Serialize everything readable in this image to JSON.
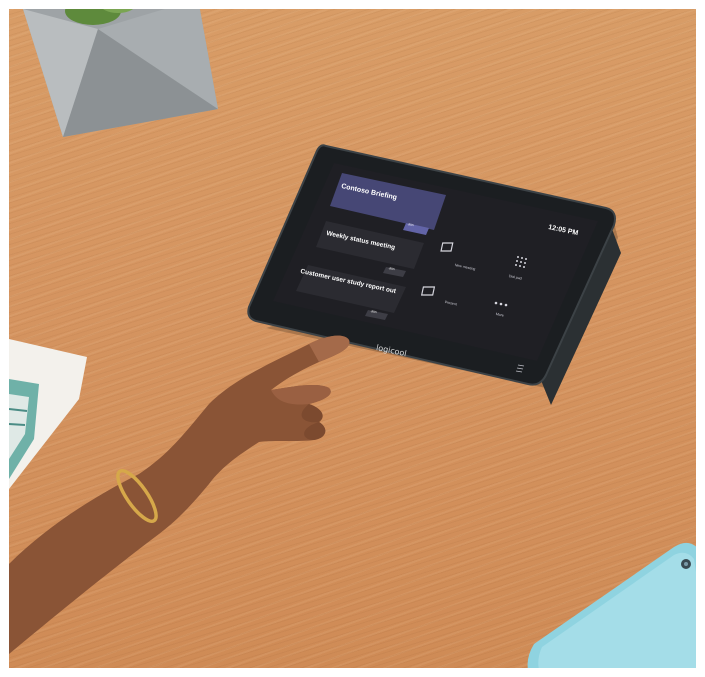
{
  "device": {
    "brand": "logicool",
    "clock": "12:05 PM",
    "meetings": [
      {
        "title": "Contoso Briefing",
        "action": "Join"
      },
      {
        "title": "Weekly status meeting",
        "action": "Join"
      },
      {
        "title": "Customer user study report out",
        "action": "Join"
      }
    ],
    "tiles": [
      {
        "label": "New meeting",
        "icon": "video-camera-plus-icon"
      },
      {
        "label": "Dial pad",
        "icon": "dial-pad-icon"
      },
      {
        "label": "Present",
        "icon": "present-screen-icon"
      },
      {
        "label": "More",
        "icon": "more-dots-icon"
      }
    ]
  },
  "colors": {
    "desk": "#d59460",
    "screen": "#1f1f24",
    "accent": "#6264a7",
    "phone": "#8fd3e0"
  }
}
